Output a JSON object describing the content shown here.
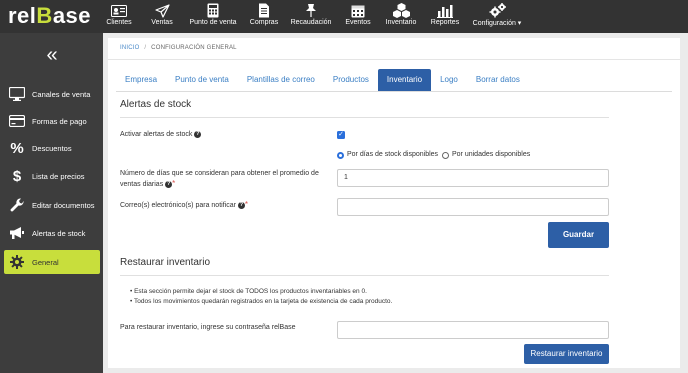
{
  "app": {
    "logo_prefix": "rel",
    "logo_accent": "B",
    "logo_suffix": "ase"
  },
  "topnav": [
    {
      "label": "Clientes",
      "icon": "id-card-icon"
    },
    {
      "label": "Ventas",
      "icon": "paper-plane-icon"
    },
    {
      "label": "Punto de venta",
      "icon": "calculator-icon"
    },
    {
      "label": "Compras",
      "icon": "document-icon"
    },
    {
      "label": "Recaudación",
      "icon": "pin-icon"
    },
    {
      "label": "Eventos",
      "icon": "calendar-icon"
    },
    {
      "label": "Inventario",
      "icon": "cubes-icon"
    },
    {
      "label": "Reportes",
      "icon": "bar-chart-icon"
    },
    {
      "label": "Configuración ▾",
      "icon": "gears-icon"
    }
  ],
  "sidebar": {
    "collapse_glyph": "«",
    "items": [
      {
        "label": "Canales de venta",
        "icon": "monitor-icon"
      },
      {
        "label": "Formas de pago",
        "icon": "credit-card-icon"
      },
      {
        "label": "Descuentos",
        "icon": "percent-icon"
      },
      {
        "label": "Lista de precios",
        "icon": "dollar-icon"
      },
      {
        "label": "Editar documentos",
        "icon": "wrench-icon"
      },
      {
        "label": "Alertas de stock",
        "icon": "megaphone-icon"
      },
      {
        "label": "General",
        "icon": "gear-icon",
        "active": true
      }
    ]
  },
  "breadcrumb": {
    "home": "INICIO",
    "separator": "/",
    "current": "CONFIGURACIÓN GENERAL"
  },
  "tabs": [
    {
      "label": "Empresa"
    },
    {
      "label": "Punto de venta"
    },
    {
      "label": "Plantillas de correo"
    },
    {
      "label": "Productos"
    },
    {
      "label": "Inventario",
      "active": true
    },
    {
      "label": "Logo"
    },
    {
      "label": "Borrar datos"
    }
  ],
  "stock_alerts": {
    "title": "Alertas de stock",
    "activate_label": "Activar alertas de stock",
    "activate_checked": true,
    "radio_option_1": "Por días de stock disponibles",
    "radio_option_2": "Por unidades disponibles",
    "days_label_line1": "Número de días que se consideran para obtener el promedio de",
    "days_label_line2": "ventas diarias",
    "days_value": "1",
    "email_label": "Correo(s) electrónico(s) para notificar",
    "email_value": "",
    "save_label": "Guardar"
  },
  "restore": {
    "title": "Restaurar inventario",
    "bullet_1": "Esta sección permite dejar el stock de TODOS los productos inventariables en 0.",
    "bullet_2": "Todos los movimientos quedarán registrados en la tarjeta de existencia de cada producto.",
    "password_label": "Para restaurar inventario, ingrese su contraseña relBase",
    "password_value": "",
    "button_label": "Restaurar inventario"
  },
  "colors": {
    "topbar": "#333333",
    "sidebar": "#3d3d3d",
    "accent": "#c8de3c",
    "primary": "#2d5fa6"
  }
}
